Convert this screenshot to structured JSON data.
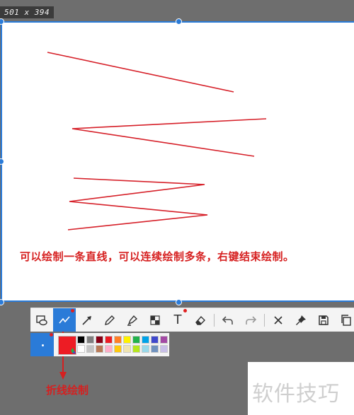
{
  "size_badge": "501 x 394",
  "capture": {
    "caption": "可以绘制一条直线，可以连续绘制多条，右键结束绘制。",
    "stroke_color": "#d62029"
  },
  "toolbar": {
    "accent": "#2a7bd8",
    "tools": [
      {
        "name": "shape-tool",
        "icon": "rectangle-ellipse-icon"
      },
      {
        "name": "polyline-tool",
        "icon": "polyline-icon",
        "active": true
      },
      {
        "name": "arrow-tool",
        "icon": "arrow-icon"
      },
      {
        "name": "pen-tool",
        "icon": "pencil-icon"
      },
      {
        "name": "highlighter-tool",
        "icon": "highlighter-icon"
      },
      {
        "name": "mosaic-tool",
        "icon": "mosaic-icon"
      },
      {
        "name": "text-tool",
        "icon": "text-icon",
        "label": "T"
      },
      {
        "name": "eraser-tool",
        "icon": "eraser-icon"
      },
      {
        "name": "undo-tool",
        "icon": "undo-icon"
      },
      {
        "name": "redo-tool",
        "icon": "redo-icon"
      },
      {
        "name": "close-tool",
        "icon": "close-icon"
      },
      {
        "name": "pin-tool",
        "icon": "pin-icon"
      },
      {
        "name": "save-tool",
        "icon": "save-icon"
      },
      {
        "name": "copy-tool",
        "icon": "copy-icon"
      }
    ]
  },
  "palette": {
    "current_color": "#ed1c24",
    "colors": [
      "#000000",
      "#7f7f7f",
      "#880015",
      "#ed1c24",
      "#ff7f27",
      "#fff200",
      "#22b14c",
      "#00a2e8",
      "#3f48cc",
      "#a349a4",
      "",
      "#ffffff",
      "#c3c3c3",
      "#b97a57",
      "#ffaec9",
      "#ffc90e",
      "#efe4b0",
      "#b5e61d",
      "#99d9ea",
      "#7092be",
      "#c8bfe7",
      ""
    ]
  },
  "annotation_label": "折线绘制",
  "watermark": "软件技巧"
}
